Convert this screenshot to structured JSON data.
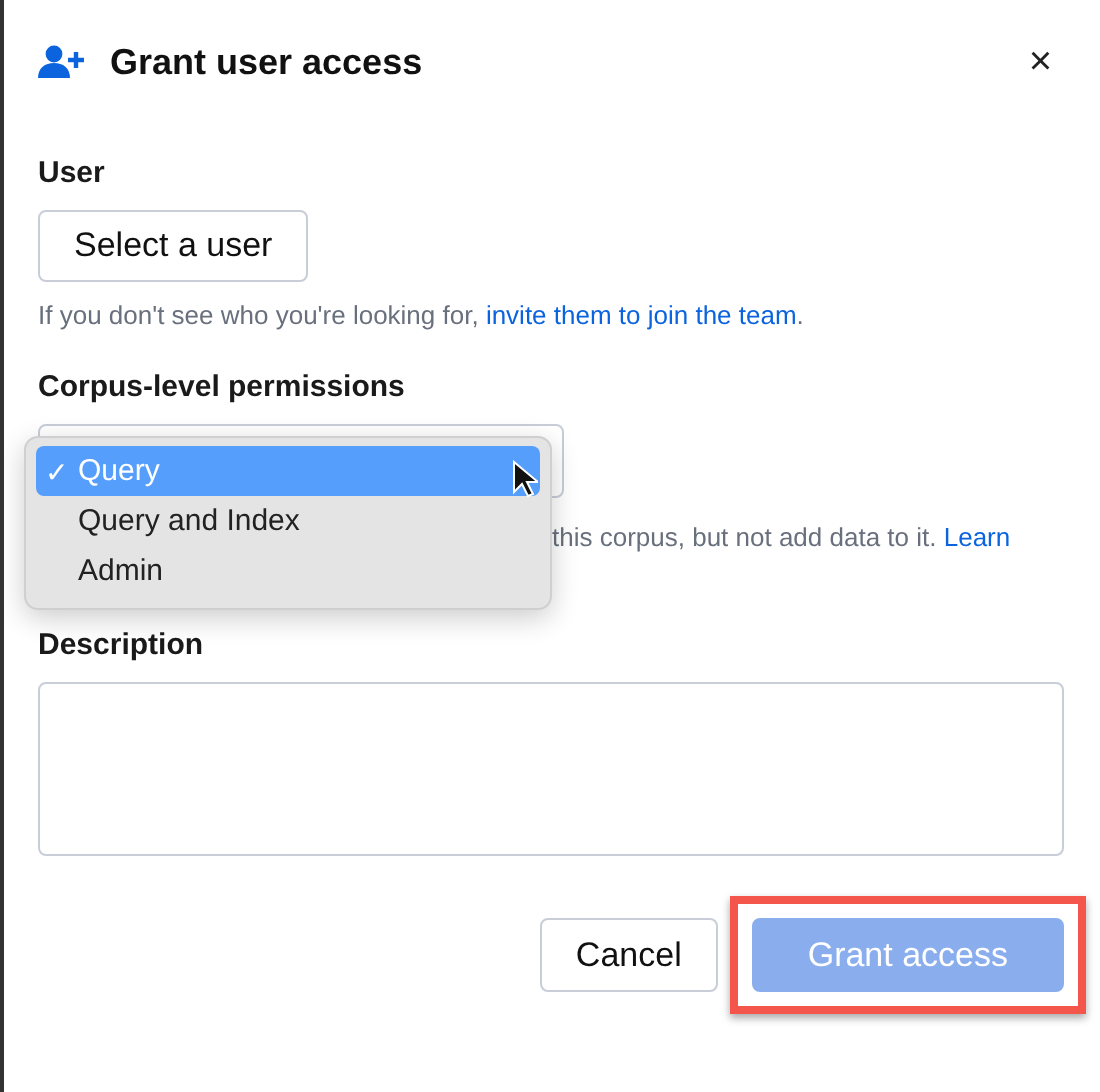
{
  "dialog": {
    "title": "Grant user access",
    "close": "×"
  },
  "user": {
    "label": "User",
    "button": "Select a user",
    "help": "If you don't see who you're looking for, ",
    "help_link": "invite them to join the team",
    "help_end": "."
  },
  "permissions": {
    "label": "Corpus-level permissions",
    "help": "this corpus, but not add data to it.",
    "help_link": "Learn",
    "options": [
      {
        "label": "Query",
        "selected": true,
        "check": "✓"
      },
      {
        "label": "Query and Index",
        "selected": false
      },
      {
        "label": "Admin",
        "selected": false
      }
    ]
  },
  "description": {
    "label": "Description"
  },
  "buttons": [
    {
      "label": "Cancel",
      "kind": "secondary",
      "highlighted": false
    },
    {
      "label": "Grant access",
      "kind": "primary",
      "disabled": true,
      "highlighted": true
    }
  ]
}
